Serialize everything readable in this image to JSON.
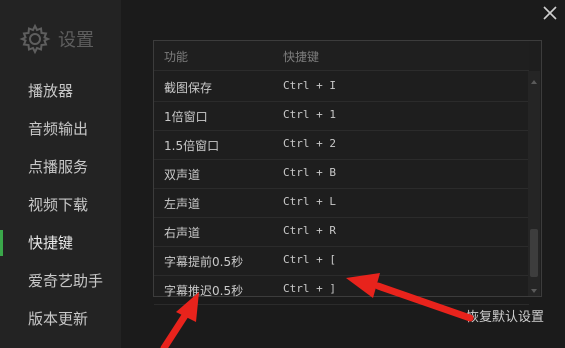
{
  "header": {
    "title": "设置"
  },
  "sidebar": {
    "items": [
      {
        "label": "播放器"
      },
      {
        "label": "音频输出"
      },
      {
        "label": "点播服务"
      },
      {
        "label": "视频下载"
      },
      {
        "label": "快捷键"
      },
      {
        "label": "爱奇艺助手"
      },
      {
        "label": "版本更新"
      }
    ],
    "active_index": 4
  },
  "table": {
    "columns": {
      "function": "功能",
      "shortcut": "快捷键"
    },
    "rows": [
      {
        "function": "截图保存",
        "shortcut": "Ctrl + I"
      },
      {
        "function": "1倍窗口",
        "shortcut": "Ctrl + 1"
      },
      {
        "function": "1.5倍窗口",
        "shortcut": "Ctrl + 2"
      },
      {
        "function": "双声道",
        "shortcut": "Ctrl + B"
      },
      {
        "function": "左声道",
        "shortcut": "Ctrl + L"
      },
      {
        "function": "右声道",
        "shortcut": "Ctrl + R"
      },
      {
        "function": "字幕提前0.5秒",
        "shortcut": "Ctrl + ["
      },
      {
        "function": "字幕推迟0.5秒",
        "shortcut": "Ctrl + ]"
      }
    ]
  },
  "footer": {
    "reset_label": "恢复默认设置"
  },
  "icons": {
    "brand": "gear-icon",
    "close": "close-icon"
  },
  "colors": {
    "accent": "#3aa74a",
    "annotation": "#e8231c",
    "background": "#1b1b1b"
  }
}
